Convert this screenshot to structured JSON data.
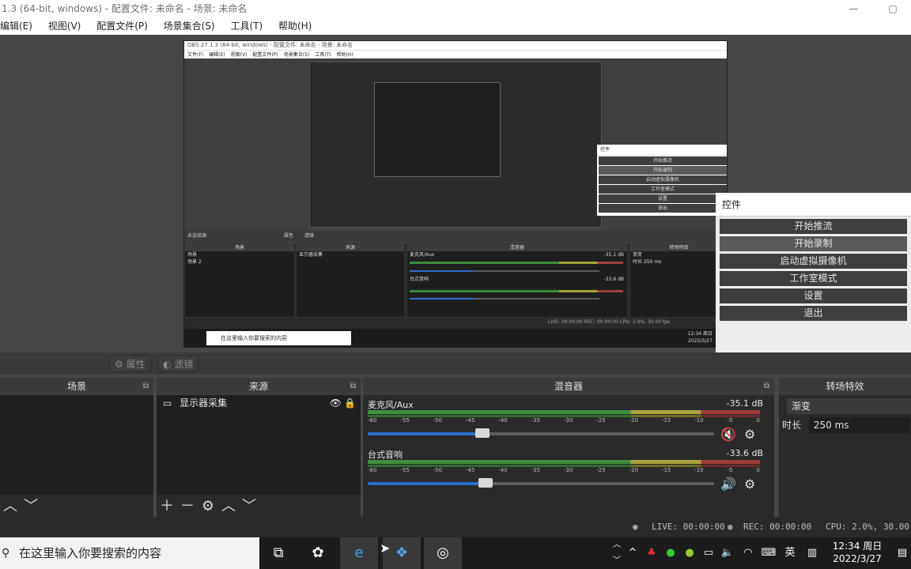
{
  "window": {
    "title": "1.3 (64-bit, windows) - 配置文件: 未命名 - 场景: 未命名",
    "btn_min": "—",
    "btn_max": "▢"
  },
  "menu": [
    "编辑(E)",
    "视图(V)",
    "配置文件(P)",
    "场景集合(S)",
    "工具(T)",
    "帮助(H)"
  ],
  "nested": {
    "title": "OBS 27.1.3 (64-bit, windows) - 配置文件: 未命名 - 场景: 未命名",
    "menu": [
      "文件(F)",
      "编辑(E)",
      "视图(V)",
      "配置文件(P)",
      "场景集合(S)",
      "工具(T)",
      "帮助(H)"
    ],
    "controls_title": "控件",
    "controls": [
      "开始推流",
      "开始录制",
      "启动虚拟摄像机",
      "工作室模式",
      "设置",
      "退出"
    ],
    "no_source": "未选择源",
    "prop_label": "属性",
    "filter_label": "滤镜",
    "docks": {
      "scenes": "场景",
      "sources": "来源",
      "mixer": "混音器",
      "transitions": "转场特效"
    },
    "scene_items": [
      "场景",
      "场景 2"
    ],
    "source_item": "显示器采集",
    "mic_name": "麦克风/Aux",
    "mic_db": "-35.1 dB",
    "desk_name": "台式音响",
    "desk_db": "-33.6 dB",
    "transition": "渐变",
    "duration_label": "时长",
    "duration": "250 ms",
    "status": "LIVE: 00:00:00   REC: 00:00:00   CPU: 2.0%, 30.00 fps",
    "search": "在这里输入你要搜索的内容",
    "clock_time": "12:34 周日",
    "clock_date": "2022/3/27"
  },
  "controls_dock": {
    "title": "控件",
    "buttons": [
      "开始推流",
      "开始录制",
      "启动虚拟摄像机",
      "工作室模式",
      "设置",
      "退出"
    ],
    "highlighted_index": 1
  },
  "properties_bar": {
    "properties": "属性",
    "filters": "滤镜"
  },
  "scenes_dock": {
    "title": "场景"
  },
  "sources_dock": {
    "title": "来源",
    "item": "显示器采集"
  },
  "mixer_dock": {
    "title": "混音器",
    "scale": [
      "-60",
      "-55",
      "-50",
      "-45",
      "-40",
      "-35",
      "-30",
      "-25",
      "-20",
      "-15",
      "-10",
      "-5",
      "0"
    ],
    "channels": [
      {
        "name": "麦克风/Aux",
        "db": "-35.1 dB",
        "volume": 0.33,
        "muted": true
      },
      {
        "name": "台式音响",
        "db": "-33.6 dB",
        "volume": 0.34,
        "muted": false
      }
    ]
  },
  "transitions_dock": {
    "title": "转场特效",
    "transition": "渐变",
    "duration_label": "时长",
    "duration": "250 ms"
  },
  "statusbar": {
    "live": "LIVE: 00:00:00",
    "rec": "REC: 00:00:00",
    "cpu": "CPU: 2.0%, 30.00 f"
  },
  "taskbar": {
    "search_placeholder": "在这里输入你要搜索的内容",
    "ime": "英",
    "clock_time": "12:34 周日",
    "clock_date": "2022/3/27"
  },
  "icons": {
    "gear": "gear-icon",
    "eye": "eye-icon",
    "lock": "lock-icon",
    "speaker": "speaker-icon",
    "muted": "speaker-muted-icon",
    "monitor": "monitor-icon"
  }
}
